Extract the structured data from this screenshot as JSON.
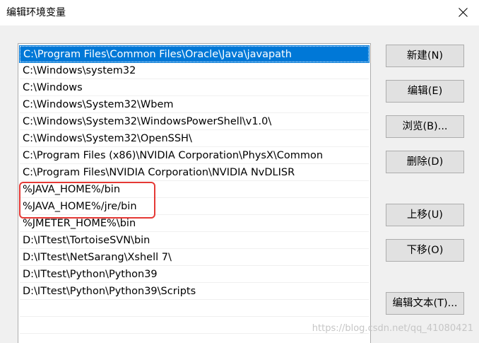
{
  "window": {
    "title": "编辑环境变量",
    "close_icon": "close-icon"
  },
  "path_list": {
    "items": [
      "C:\\Program Files\\Common Files\\Oracle\\Java\\javapath",
      "C:\\Windows\\system32",
      "C:\\Windows",
      "C:\\Windows\\System32\\Wbem",
      "C:\\Windows\\System32\\WindowsPowerShell\\v1.0\\",
      "C:\\Windows\\System32\\OpenSSH\\",
      "C:\\Program Files (x86)\\NVIDIA Corporation\\PhysX\\Common",
      "C:\\Program Files\\NVIDIA Corporation\\NVIDIA NvDLISR",
      "%JAVA_HOME%/bin",
      "%JAVA_HOME%/jre/bin",
      "%JMETER_HOME%\\bin",
      "D:\\ITtest\\TortoiseSVN\\bin",
      "D:\\ITtest\\NetSarang\\Xshell 7\\",
      "D:\\ITtest\\Python\\Python39",
      "D:\\ITtest\\Python\\Python39\\Scripts",
      "",
      ""
    ],
    "selected_index": 0,
    "selection_color": "#0078d7",
    "annotation_color": "#e53935"
  },
  "buttons": {
    "new": "新建(N)",
    "edit": "编辑(E)",
    "browse": "浏览(B)...",
    "delete": "删除(D)",
    "move_up": "上移(U)",
    "move_down": "下移(O)",
    "edit_text": "编辑文本(T)..."
  },
  "watermark": "https://blog.csdn.net/qq_41080421"
}
